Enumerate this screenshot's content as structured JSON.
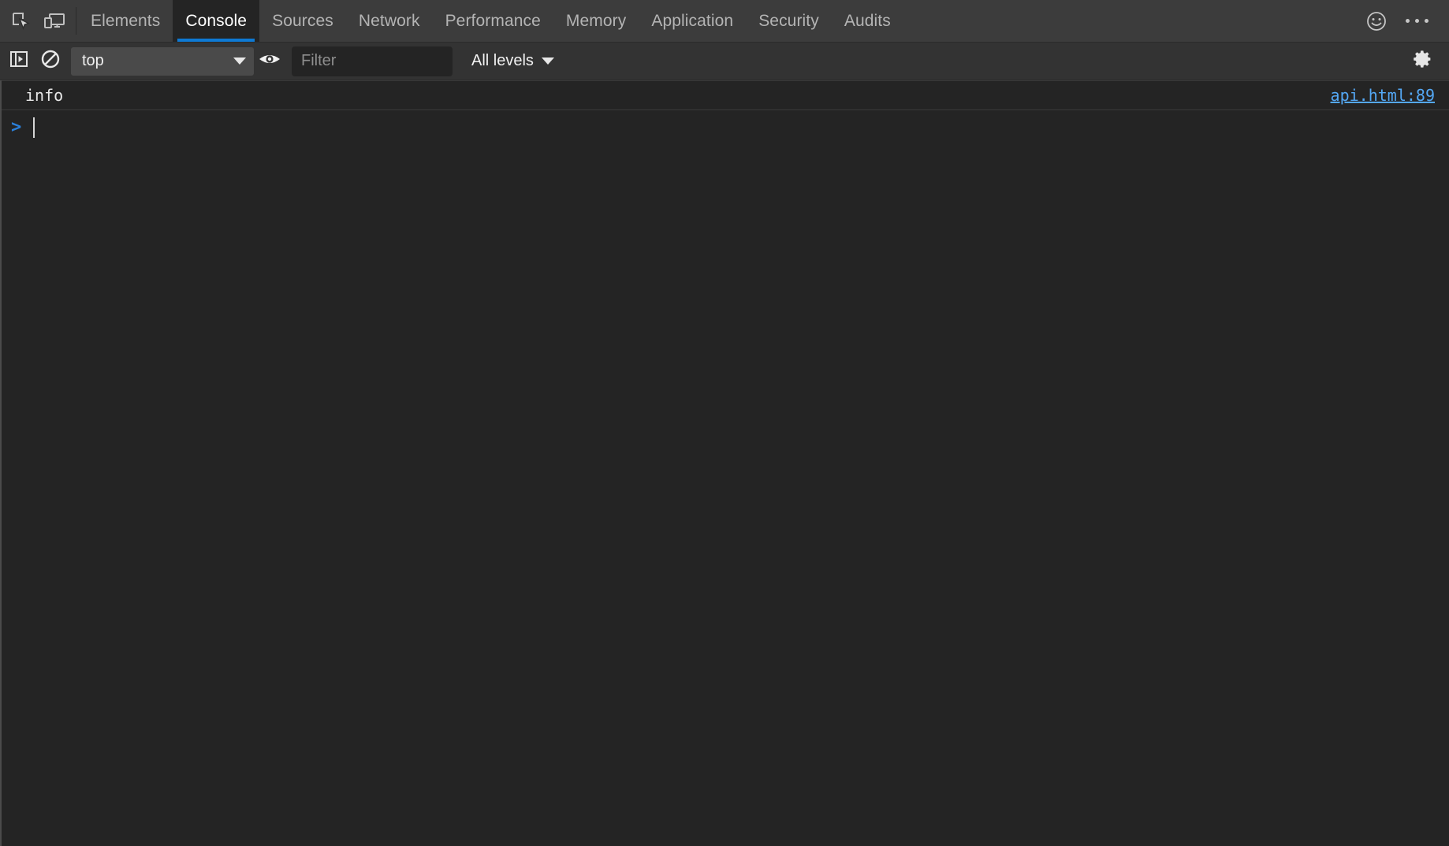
{
  "window": {
    "app": "Chrome DevTools",
    "theme_background": "#242424",
    "accent_color": "#0e7ad4",
    "link_color": "#54a8f5"
  },
  "tabbar": {
    "inspect_icon": "inspect-element-icon",
    "device_icon": "device-toolbar-icon",
    "tabs": [
      {
        "label": "Elements",
        "active": false
      },
      {
        "label": "Console",
        "active": true
      },
      {
        "label": "Sources",
        "active": false
      },
      {
        "label": "Network",
        "active": false
      },
      {
        "label": "Performance",
        "active": false
      },
      {
        "label": "Memory",
        "active": false
      },
      {
        "label": "Application",
        "active": false
      },
      {
        "label": "Security",
        "active": false
      },
      {
        "label": "Audits",
        "active": false
      }
    ],
    "feedback_icon": "smiley-face-icon",
    "more_icon": "more-options-icon"
  },
  "console_toolbar": {
    "sidebar_toggle_icon": "console-sidebar-toggle-icon",
    "clear_icon": "clear-console-icon",
    "context": {
      "value": "top",
      "caret_icon": "chevron-down-icon"
    },
    "live_expression_icon": "eye-icon",
    "filter": {
      "value": "",
      "placeholder": "Filter"
    },
    "levels": {
      "value": "All levels",
      "caret_icon": "chevron-down-icon"
    },
    "settings_icon": "gear-icon"
  },
  "console_body": {
    "messages": [
      {
        "text": "info",
        "source": "api.html:89",
        "level": "info"
      }
    ],
    "prompt": {
      "chevron": ">",
      "value": ""
    }
  }
}
